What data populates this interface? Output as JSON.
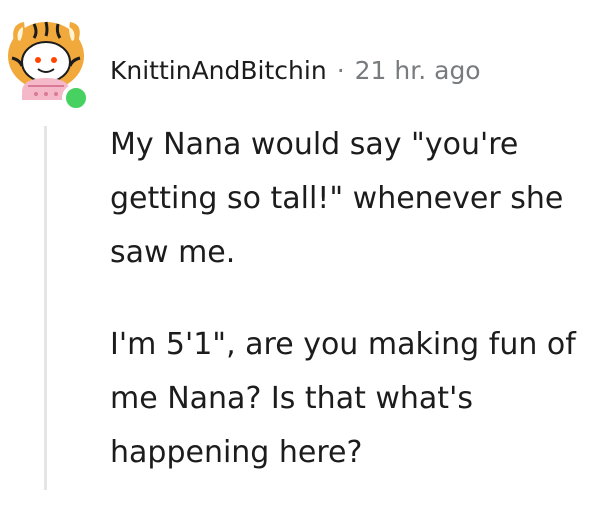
{
  "comment": {
    "author": "KnittinAndBitchin",
    "separator": "·",
    "timestamp": "21 hr. ago",
    "online_status_color": "#46d160",
    "avatar_icon": "snoo-avatar-tiger-hat",
    "paragraphs": [
      "My Nana would say \"you're getting so tall!\" whenever she saw me.",
      "I'm 5'1\", are you making fun of me Nana? Is that what's happening here?"
    ]
  }
}
